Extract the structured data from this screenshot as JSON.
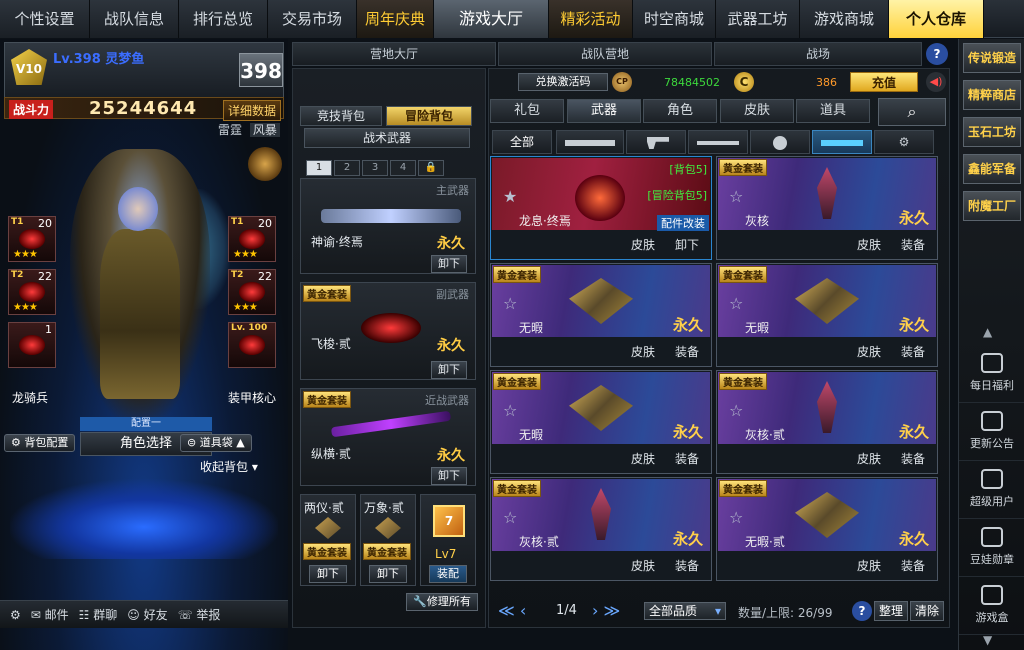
{
  "top_nav": [
    {
      "label": "个性设置",
      "style": "normal"
    },
    {
      "label": "战队信息",
      "style": "normal"
    },
    {
      "label": "排行总览",
      "style": "normal"
    },
    {
      "label": "交易市场",
      "style": "normal"
    },
    {
      "label": "周年庆典",
      "style": "gold"
    },
    {
      "label": "游戏大厅",
      "style": "hall"
    },
    {
      "label": "精彩活动",
      "style": "gold"
    },
    {
      "label": "时空商城",
      "style": "normal"
    },
    {
      "label": "武器工坊",
      "style": "normal"
    },
    {
      "label": "游戏商城",
      "style": "normal"
    },
    {
      "label": "个人仓库",
      "style": "active"
    }
  ],
  "sub_tabs": [
    "营地大厅",
    "战队营地",
    "战场"
  ],
  "player": {
    "level_label": "Lv.398",
    "name": "灵梦鱼",
    "level_badge": "398",
    "emblem_text": "V10",
    "power_label": "战斗力",
    "power_value": "25244644",
    "detail_button": "详细数据",
    "tag_1": "雷霆",
    "tag_2": "风暴"
  },
  "slots_left": [
    {
      "tier": "T1",
      "count": "20",
      "stars": "★★★"
    },
    {
      "tier": "T2",
      "count": "22",
      "stars": "★★★"
    },
    {
      "tier": "",
      "count": "1",
      "stars": ""
    }
  ],
  "slots_right": [
    {
      "tier": "T1",
      "count": "20",
      "stars": "★★★"
    },
    {
      "tier": "T2",
      "count": "22",
      "stars": "★★★"
    },
    {
      "tier": "Lv. 100",
      "count": "",
      "stars": ""
    }
  ],
  "slot_captions": {
    "left": "龙骑兵",
    "right": "装甲核心"
  },
  "config_label": "配置一",
  "role_select": "角色选择",
  "bag_config": "背包配置",
  "tool_bag": "道具袋",
  "collapse_bag": "收起背包",
  "bottom_bar": {
    "mail": "邮件",
    "group_chat": "群聊",
    "friends": "好友",
    "report": "举报"
  },
  "bag_tabs": {
    "arena": "竞技背包",
    "adventure": "冒险背包"
  },
  "tactical_weapons": "战术武器",
  "page_tabs": [
    "1",
    "2",
    "3",
    "4"
  ],
  "weapons": {
    "primary": {
      "type": "主武器",
      "name": "神谕·终焉",
      "perm": "永久",
      "action": "卸下",
      "badge": ""
    },
    "secondary": {
      "type": "副武器",
      "name": "飞梭·贰",
      "perm": "永久",
      "action": "卸下",
      "badge": "黄金套装"
    },
    "melee": {
      "type": "近战武器",
      "name": "纵横·贰",
      "perm": "永久",
      "action": "卸下",
      "badge": "黄金套装"
    }
  },
  "throwables": [
    {
      "name": "两仪·贰",
      "badge": "黄金套装",
      "action": "卸下"
    },
    {
      "name": "万象·贰",
      "badge": "黄金套装",
      "action": "卸下"
    },
    {
      "name": "Lv7",
      "badge": "",
      "action": "装配"
    }
  ],
  "repair_all": "修理所有",
  "currency": {
    "redeem_code": "兑换激活码",
    "cp_value": "78484502",
    "gold_value": "386",
    "recharge": "充值",
    "cp_icon": "CP",
    "coin_icon": "C"
  },
  "category_tabs": [
    "礼包",
    "武器",
    "角色",
    "皮肤",
    "道具"
  ],
  "filter_all": "全部",
  "cards": [
    {
      "name": "龙息·终焉",
      "badge": "",
      "perm": "",
      "bag": "[背包5]",
      "bag2": "[冒险背包5]",
      "mod": "配件改装",
      "btn1": "皮肤",
      "btn2": "卸下",
      "style": "red"
    },
    {
      "name": "灰核",
      "badge": "黄金套装",
      "perm": "永久",
      "btn1": "皮肤",
      "btn2": "装备",
      "style": "dagger"
    },
    {
      "name": "无暇",
      "badge": "黄金套装",
      "perm": "永久",
      "btn1": "皮肤",
      "btn2": "装备",
      "style": "gem"
    },
    {
      "name": "无暇",
      "badge": "黄金套装",
      "perm": "永久",
      "btn1": "皮肤",
      "btn2": "装备",
      "style": "gem"
    },
    {
      "name": "无暇",
      "badge": "黄金套装",
      "perm": "永久",
      "btn1": "皮肤",
      "btn2": "装备",
      "style": "gem"
    },
    {
      "name": "灰核·贰",
      "badge": "黄金套装",
      "perm": "永久",
      "btn1": "皮肤",
      "btn2": "装备",
      "style": "dagger"
    },
    {
      "name": "灰核·贰",
      "badge": "黄金套装",
      "perm": "永久",
      "btn1": "皮肤",
      "btn2": "装备",
      "style": "dagger"
    },
    {
      "name": "无暇·贰",
      "badge": "黄金套装",
      "perm": "永久",
      "btn1": "皮肤",
      "btn2": "装备",
      "style": "gem"
    }
  ],
  "pagination": {
    "page": "1/4",
    "quality": "全部品质",
    "capacity": "数量/上限: 26/99",
    "sort": "整理",
    "clear": "清除",
    "help": "?"
  },
  "right_sidebar": {
    "gold_items": [
      "传说锻造",
      "精粹商店",
      "玉石工坊",
      "鑫能军备",
      "附魔工厂"
    ],
    "items": [
      "每日福利",
      "更新公告",
      "超级用户",
      "豆娃勋章",
      "游戏盒"
    ]
  }
}
